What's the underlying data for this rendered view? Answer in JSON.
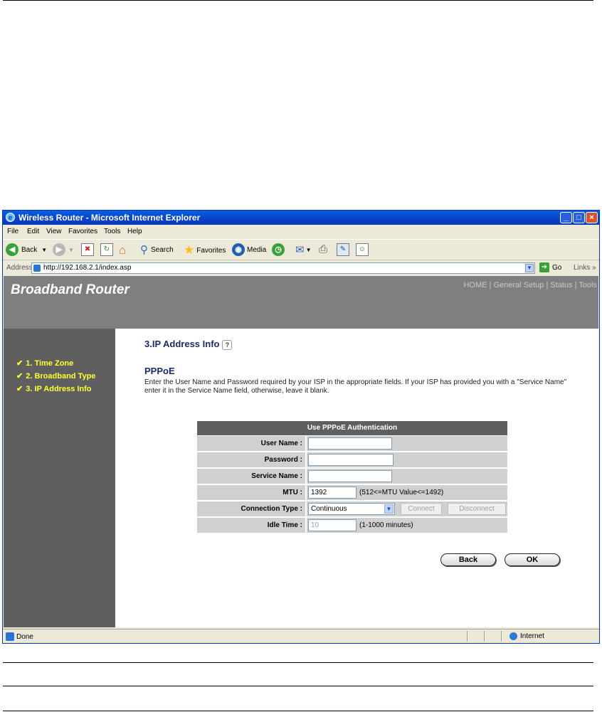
{
  "window": {
    "title": "Wireless Router - Microsoft Internet Explorer",
    "buttons": {
      "minimize": "_",
      "maximize": "□",
      "close": "×"
    }
  },
  "menu": {
    "items": [
      {
        "label": "File"
      },
      {
        "label": "Edit"
      },
      {
        "label": "View"
      },
      {
        "label": "Favorites"
      },
      {
        "label": "Tools"
      },
      {
        "label": "Help"
      }
    ]
  },
  "toolbar": {
    "back": "Back",
    "search": "Search",
    "favorites": "Favorites",
    "media": "Media"
  },
  "address": {
    "label": "Address",
    "url": "http://192.168.2.1/index.asp",
    "go": "Go",
    "links": "Links »"
  },
  "banner": {
    "brand": "Broadband Router",
    "nav": "HOME | General Setup | Status | Tools"
  },
  "sidebar": {
    "steps": [
      {
        "label": "1. Time Zone"
      },
      {
        "label": "2. Broadband Type"
      },
      {
        "label": "3. IP Address Info"
      }
    ]
  },
  "main": {
    "heading": "3.IP Address Info",
    "section": "PPPoE",
    "description": "Enter the User Name and Password required by your ISP in the appropriate fields. If your ISP has provided you with a \"Service Name\" enter it in the Service Name field, otherwise, leave it blank."
  },
  "form": {
    "header": "Use PPPoE Authentication",
    "user_name_label": "User Name :",
    "user_name_value": "",
    "password_label": "Password :",
    "password_value": "",
    "service_name_label": "Service Name :",
    "service_name_value": "",
    "mtu_label": "MTU :",
    "mtu_value": "1392",
    "mtu_hint": "(512<=MTU Value<=1492)",
    "conn_type_label": "Connection Type :",
    "conn_type_value": "Continuous",
    "connect_button": "Connect",
    "disconnect_button": "Disconnect",
    "idle_label": "Idle Time :",
    "idle_value": "10",
    "idle_hint": "(1-1000 minutes)"
  },
  "actions": {
    "back": "Back",
    "ok": "OK"
  },
  "status": {
    "text": "Done",
    "zone": "Internet"
  }
}
